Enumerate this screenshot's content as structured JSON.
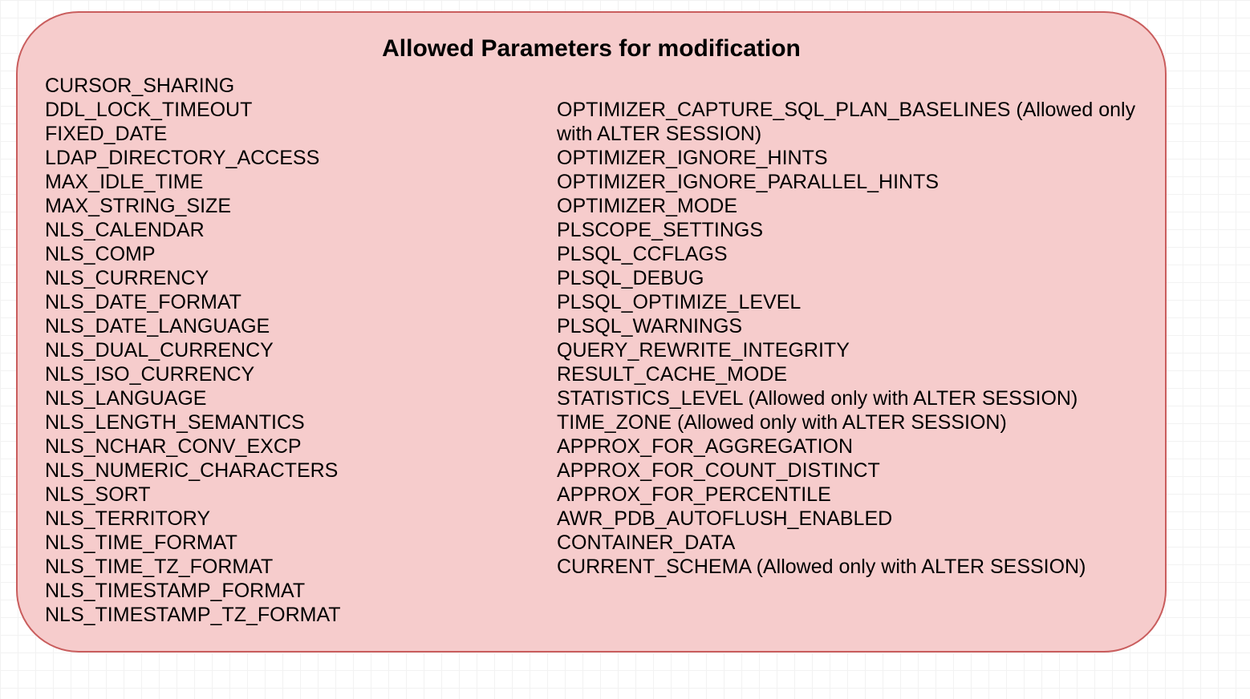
{
  "title": "Allowed Parameters for modification",
  "left_items": [
    "CURSOR_SHARING",
    "DDL_LOCK_TIMEOUT",
    "FIXED_DATE",
    "LDAP_DIRECTORY_ACCESS",
    "MAX_IDLE_TIME",
    "MAX_STRING_SIZE",
    "NLS_CALENDAR",
    "NLS_COMP",
    "NLS_CURRENCY",
    "NLS_DATE_FORMAT",
    "NLS_DATE_LANGUAGE",
    "NLS_DUAL_CURRENCY",
    "NLS_ISO_CURRENCY",
    "NLS_LANGUAGE",
    "NLS_LENGTH_SEMANTICS",
    "NLS_NCHAR_CONV_EXCP",
    "NLS_NUMERIC_CHARACTERS",
    "NLS_SORT",
    "NLS_TERRITORY",
    "NLS_TIME_FORMAT",
    "NLS_TIME_TZ_FORMAT",
    "NLS_TIMESTAMP_FORMAT",
    "NLS_TIMESTAMP_TZ_FORMAT"
  ],
  "right_items": [
    "OPTIMIZER_CAPTURE_SQL_PLAN_BASELINES  (Allowed only with ALTER SESSION)",
    "OPTIMIZER_IGNORE_HINTS",
    "OPTIMIZER_IGNORE_PARALLEL_HINTS",
    "OPTIMIZER_MODE",
    "PLSCOPE_SETTINGS",
    "PLSQL_CCFLAGS",
    "PLSQL_DEBUG",
    "PLSQL_OPTIMIZE_LEVEL",
    "PLSQL_WARNINGS",
    "QUERY_REWRITE_INTEGRITY",
    "RESULT_CACHE_MODE",
    "STATISTICS_LEVEL (Allowed only with ALTER SESSION)",
    "TIME_ZONE (Allowed only with ALTER SESSION)",
    "APPROX_FOR_AGGREGATION",
    "APPROX_FOR_COUNT_DISTINCT",
    "APPROX_FOR_PERCENTILE",
    "AWR_PDB_AUTOFLUSH_ENABLED",
    "CONTAINER_DATA",
    "CURRENT_SCHEMA (Allowed only with ALTER SESSION)"
  ]
}
